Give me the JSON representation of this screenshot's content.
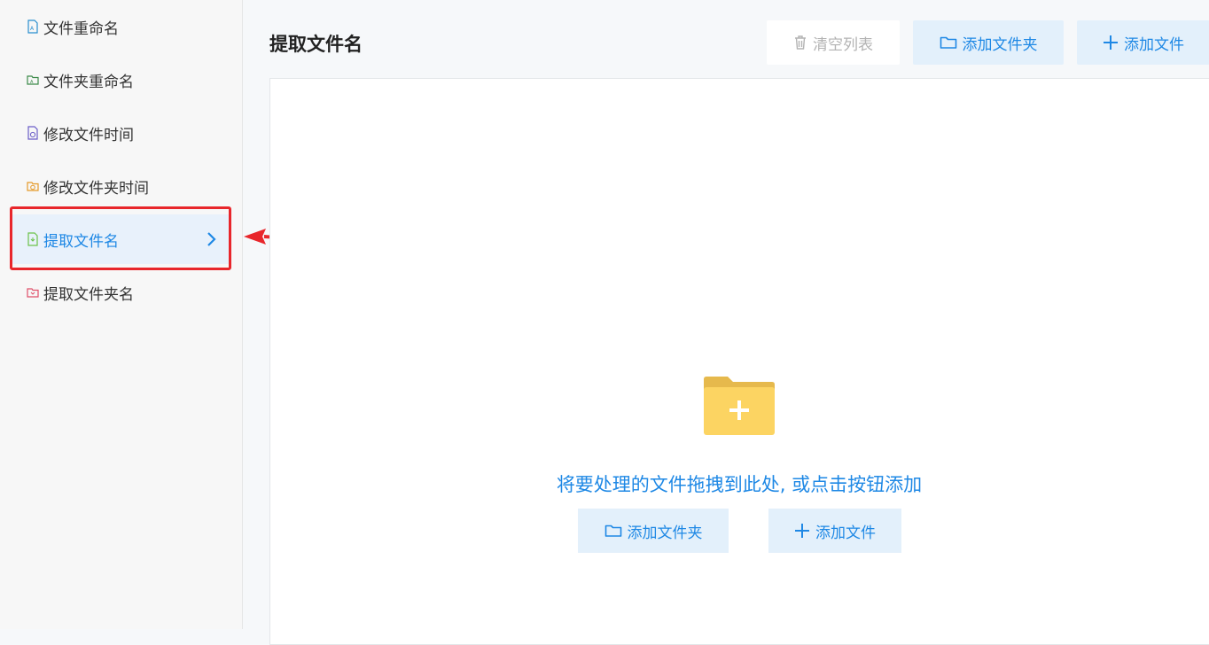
{
  "sidebar": {
    "items": [
      {
        "label": "文件重命名",
        "icon": "file-rename-icon",
        "color": "#2a8fcf"
      },
      {
        "label": "文件夹重命名",
        "icon": "folder-rename-icon",
        "color": "#3c8a4a"
      },
      {
        "label": "修改文件时间",
        "icon": "file-time-icon",
        "color": "#6b5ec8"
      },
      {
        "label": "修改文件夹时间",
        "icon": "folder-time-icon",
        "color": "#e59a2a"
      },
      {
        "label": "提取文件名",
        "icon": "extract-filename-icon",
        "color": "#6cc24a",
        "active": true
      },
      {
        "label": "提取文件夹名",
        "icon": "extract-foldername-icon",
        "color": "#e0506a"
      }
    ]
  },
  "main": {
    "title": "提取文件名",
    "toolbar": {
      "clear_label": "清空列表",
      "add_folder_label": "添加文件夹",
      "add_file_label": "添加文件"
    },
    "dropzone": {
      "hint": "将要处理的文件拖拽到此处, 或点击按钮添加",
      "add_folder_label": "添加文件夹",
      "add_file_label": "添加文件"
    }
  },
  "colors": {
    "accent": "#1e88e5",
    "highlight": "#e8262b",
    "button_bg": "#e3f0fb",
    "folder_yellow": "#fcd462"
  }
}
